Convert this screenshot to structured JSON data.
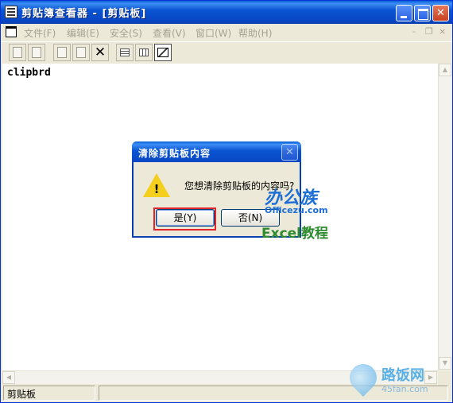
{
  "window": {
    "title": "剪贴簿查看器 - [剪贴板]",
    "minimize_glyph": "",
    "maximize_glyph": "",
    "close_glyph": "✕"
  },
  "menu": {
    "items": [
      {
        "label": "文件(F)"
      },
      {
        "label": "编辑(E)"
      },
      {
        "label": "安全(S)"
      },
      {
        "label": "查看(V)"
      },
      {
        "label": "窗口(W)"
      },
      {
        "label": "帮助(H)"
      }
    ],
    "mdi_minimize": "-",
    "mdi_restore": "❐",
    "mdi_close": "×"
  },
  "toolbar": {
    "delete_glyph": "✕"
  },
  "content": {
    "text": "clipbrd"
  },
  "scrollbar": {
    "up_glyph": "▲",
    "down_glyph": "▼",
    "left_glyph": "◀",
    "right_glyph": "▶"
  },
  "status": {
    "pane1": "剪贴板",
    "pane2": ""
  },
  "dialog": {
    "title": "清除剪贴板内容",
    "close_glyph": "✕",
    "message": "您想清除剪贴板的内容吗?",
    "icon_mark": "!",
    "yes_label": "是(Y)",
    "no_label": "否(N)"
  },
  "watermark": {
    "brand": "办公族",
    "brand_url": "Officezu.com",
    "excel_text": "Excel教程",
    "site_name": "路饭网",
    "site_url": "45fan.com"
  }
}
